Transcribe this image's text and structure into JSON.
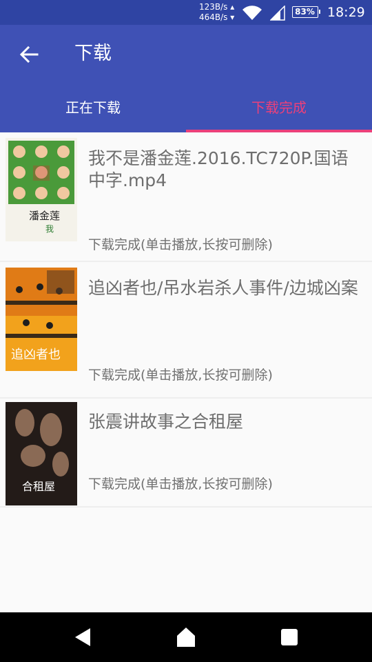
{
  "status_bar": {
    "net_up": "123B/s",
    "net_down": "464B/s",
    "battery": "83%",
    "time": "18:29"
  },
  "app_bar": {
    "title": "下载",
    "background": "#3f51b5",
    "back_icon": "arrow-back-icon"
  },
  "tabs": [
    {
      "label": "正在下载",
      "selected": false
    },
    {
      "label": "下载完成",
      "selected": true
    }
  ],
  "accent_color": "#ec407a",
  "downloads": [
    {
      "title": "我不是潘金莲.2016.TC720P.国语中字.mp4",
      "status": "下载完成(单击播放,长按可删除)",
      "poster_text": "我不是潘金莲"
    },
    {
      "title": "追凶者也/吊水岩杀人事件/边城凶案",
      "status": "下载完成(单击播放,长按可删除)",
      "poster_text": "追凶者也"
    },
    {
      "title": "张震讲故事之合租屋",
      "status": "下载完成(单击播放,长按可删除)",
      "poster_text": "合租屋"
    }
  ],
  "nav_bar": {
    "back": "nav-back-icon",
    "home": "nav-home-icon",
    "recents": "nav-recents-icon"
  }
}
